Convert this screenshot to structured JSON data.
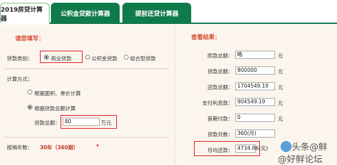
{
  "tabs": [
    {
      "label": "2019房贷计算器"
    },
    {
      "label": "公积金贷款计算器"
    },
    {
      "label": "提前还贷计算器"
    }
  ],
  "left": {
    "fill_title": "请您填写：",
    "loan_type_label": "贷款类别：",
    "loan_types": [
      "商业贷款",
      "公积金贷款",
      "组合型贷款"
    ],
    "calc_method_label": "计算方式：",
    "methods": [
      "根据面积、单价计算",
      "根据贷款总额计算"
    ],
    "total_label": "贷款总额：",
    "total_value": "80",
    "total_unit": "万元",
    "years_label": "按揭年数：",
    "years_value": "30年（360期）"
  },
  "right": {
    "title": "查看结果：",
    "rows": [
      {
        "label": "房款总额：",
        "value": "略",
        "unit": "元"
      },
      {
        "label": "贷款总额：",
        "value": "800000",
        "unit": "元"
      },
      {
        "label": "还款总额：",
        "value": "1704549.19",
        "unit": "元"
      },
      {
        "label": "支付利息款：",
        "value": "904549.19",
        "unit": "元"
      },
      {
        "label": "首期付款：",
        "value": "0",
        "unit": "元"
      },
      {
        "label": "贷款月数：",
        "value": "360(月)",
        "unit": ""
      },
      {
        "label": "月均还款：",
        "value": "4734.86(元)",
        "unit": ""
      }
    ]
  },
  "watermark": {
    "text1": "头条@鲜",
    "text2": "@好鲜论坛"
  }
}
